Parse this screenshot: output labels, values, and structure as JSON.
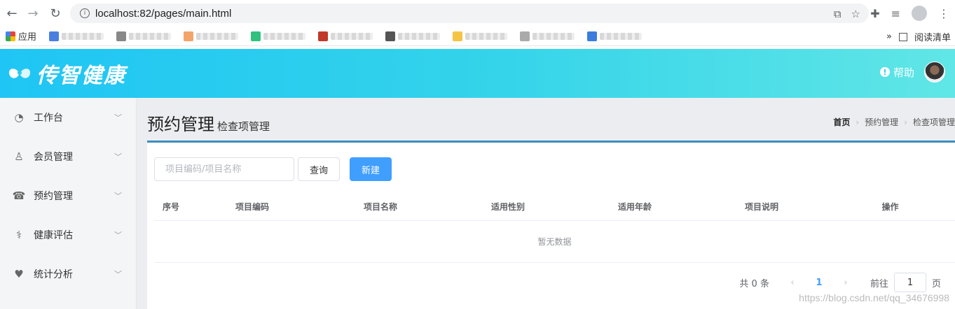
{
  "browser": {
    "url": "localhost:82/pages/main.html",
    "bookmarks": {
      "apps_label": "应用",
      "reading_list": "阅读清单"
    }
  },
  "header": {
    "logo_text": "传智健康",
    "help_label": "帮助"
  },
  "sidebar": {
    "items": [
      {
        "label": "工作台",
        "icon": "dashboard-icon"
      },
      {
        "label": "会员管理",
        "icon": "user-icon"
      },
      {
        "label": "预约管理",
        "icon": "phone-icon"
      },
      {
        "label": "健康评估",
        "icon": "stethoscope-icon"
      },
      {
        "label": "统计分析",
        "icon": "heartbeat-icon"
      }
    ]
  },
  "content": {
    "title": "预约管理",
    "subtitle": "检查项管理",
    "breadcrumb": [
      "首页",
      "预约管理",
      "检查项管理"
    ]
  },
  "toolbar": {
    "search_placeholder": "项目编码/项目名称",
    "query_label": "查询",
    "new_label": "新建"
  },
  "table": {
    "columns": [
      "序号",
      "项目编码",
      "项目名称",
      "适用性别",
      "适用年龄",
      "项目说明",
      "操作"
    ],
    "empty_text": "暂无数据"
  },
  "pagination": {
    "total_text": "共 0 条",
    "current_page": "1",
    "goto_label": "前往",
    "goto_value": "1",
    "page_suffix": "页"
  },
  "watermark": "https://blog.csdn.net/qq_34676998",
  "colors": {
    "primary": "#409eff",
    "header_start": "#1fc5f4",
    "header_end": "#60e6e6",
    "panel_border": "#3c8dbc"
  }
}
